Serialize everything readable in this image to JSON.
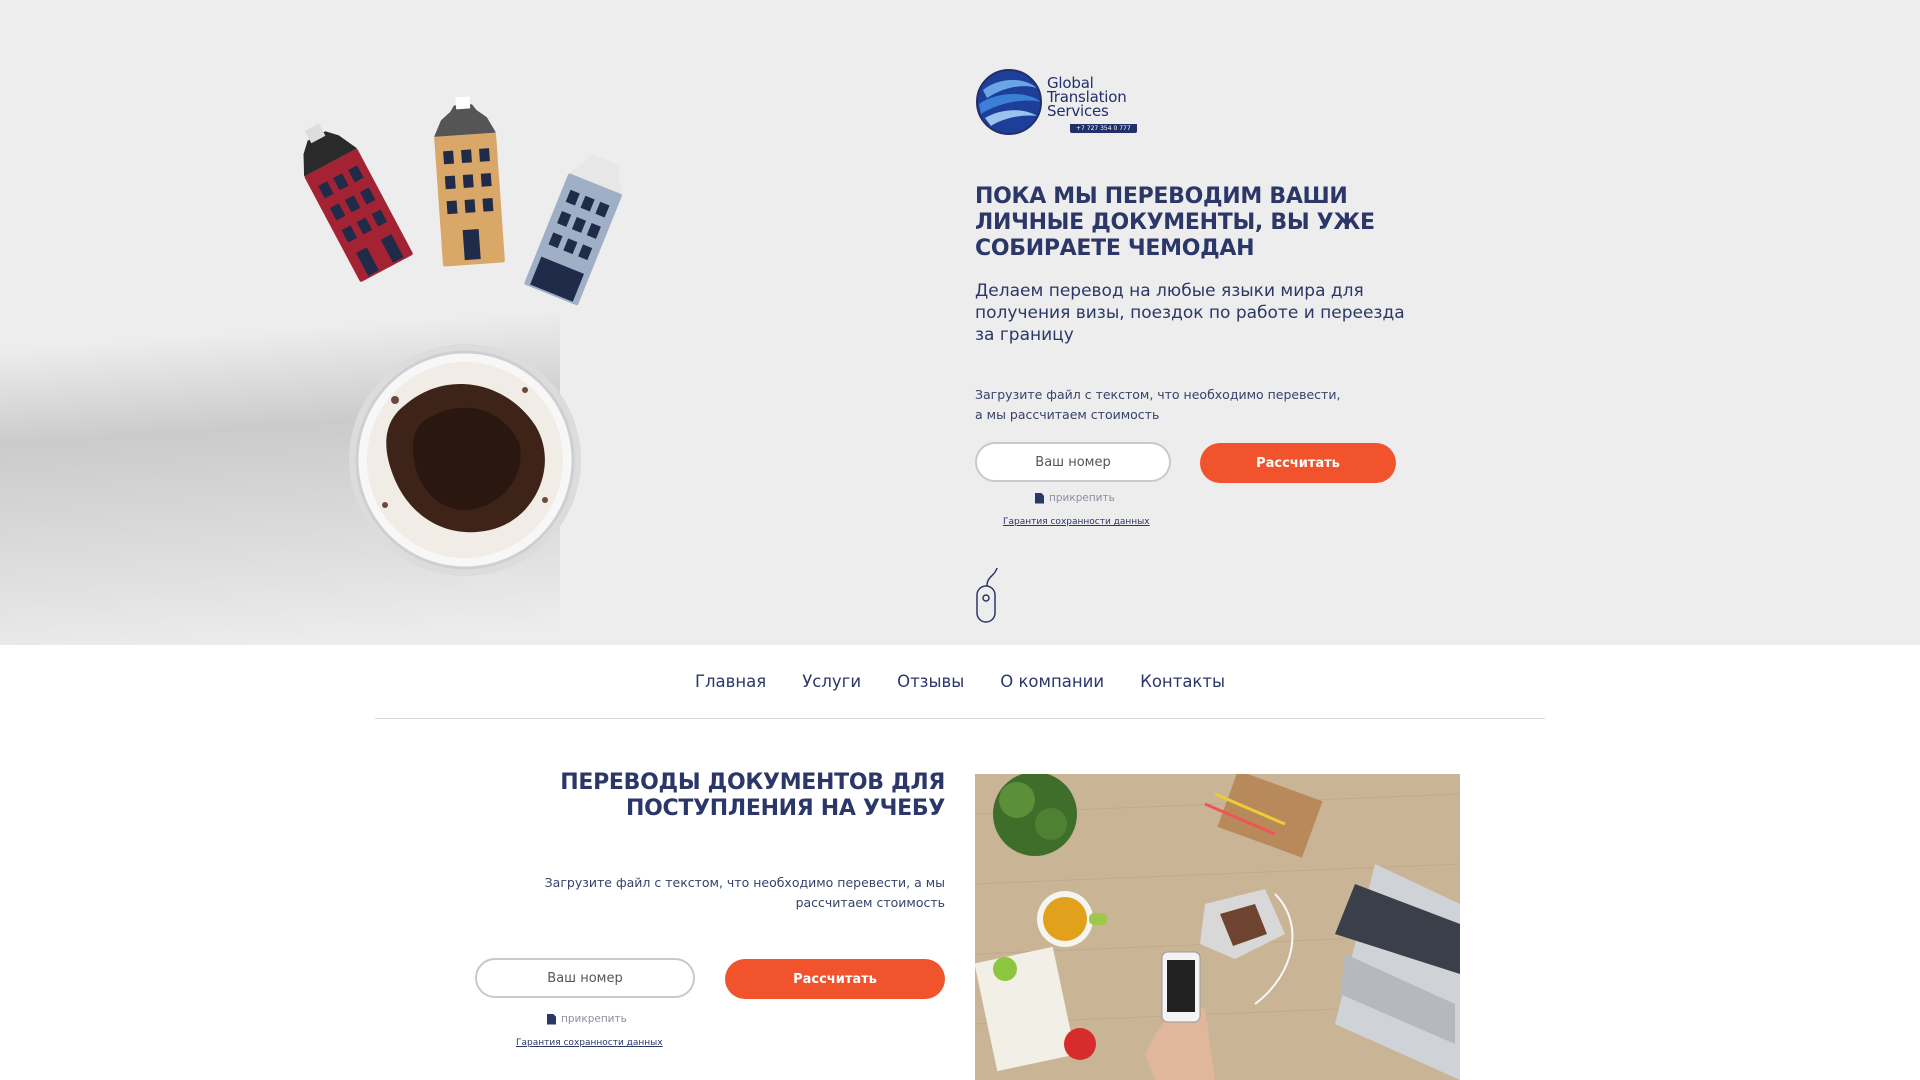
{
  "brand": {
    "line1": "Global",
    "line2": "Translation",
    "line3": "Services",
    "phone": "+7 727 354 0 777",
    "color": "#22306a"
  },
  "hero": {
    "title": "ПОКА МЫ ПЕРЕВОДИМ ВАШИ ЛИЧНЫЕ ДОКУМЕНТЫ, ВЫ УЖЕ СОБИРАЕТЕ ЧЕМОДАН",
    "subtitle": "Делаем перевод на любые языки мира для получения визы, поездок по работе и переезда за границу",
    "hint_line1": "Загрузите файл с текстом, что необходимо перевести,",
    "hint_line2": "а мы рассчитаем стоимость",
    "phone_placeholder": "Ваш номер",
    "calc_label": "Рассчитать",
    "attach_label": "прикрепить",
    "guarantee_label": "Гарантия сохранности данных",
    "scroll_icon": "mouse-scroll-icon"
  },
  "nav": {
    "items": [
      "Главная",
      "Услуги",
      "Отзывы",
      "О компании",
      "Контакты"
    ]
  },
  "section": {
    "title": "ПЕРЕВОДЫ ДОКУМЕНТОВ ДЛЯ ПОСТУПЛЕНИЯ НА УЧЕБУ",
    "hint": "Загрузите файл с текстом, что необходимо перевести, а мы рассчитаем стоимость",
    "phone_placeholder": "Ваш номер",
    "calc_label": "Рассчитать",
    "attach_label": "прикрепить",
    "guarantee_label": "Гарантия сохранности данных"
  },
  "colors": {
    "accent": "#f1542c",
    "text": "#2b3768",
    "hero_bg": "#ededed"
  }
}
